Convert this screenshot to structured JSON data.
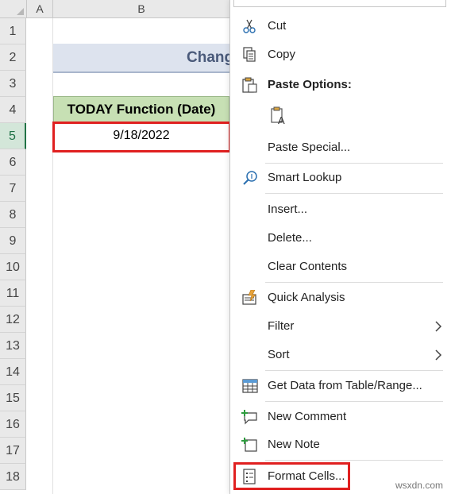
{
  "sheet": {
    "columns": [
      "A",
      "B"
    ],
    "rows": [
      "1",
      "2",
      "3",
      "4",
      "5",
      "6",
      "7",
      "8",
      "9",
      "10",
      "11",
      "12",
      "13",
      "14",
      "15",
      "16",
      "17",
      "18"
    ],
    "title_partial": "Chang",
    "header_cell": "TODAY Function (Date)",
    "value_cell": "9/18/2022",
    "active_row": "5"
  },
  "menu": {
    "cut": "Cut",
    "copy": "Copy",
    "paste_options": "Paste Options:",
    "paste_special": "Paste Special...",
    "smart_lookup": "Smart Lookup",
    "insert": "Insert...",
    "delete": "Delete...",
    "clear_contents": "Clear Contents",
    "quick_analysis": "Quick Analysis",
    "filter": "Filter",
    "sort": "Sort",
    "get_data": "Get Data from Table/Range...",
    "new_comment": "New Comment",
    "new_note": "New Note",
    "format_cells": "Format Cells..."
  },
  "colors": {
    "accent_green": "#217346",
    "highlight_red": "#e02020",
    "header_fill": "#c7e0b4"
  },
  "watermark": "wsxdn.com"
}
